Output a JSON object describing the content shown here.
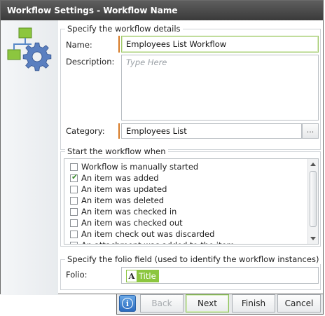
{
  "window": {
    "title": "Workflow Settings - Workflow Name"
  },
  "details": {
    "legend": "Specify the workflow details",
    "name_label": "Name:",
    "name_value": "Employees List Workflow",
    "description_label": "Description:",
    "description_placeholder": "Type Here",
    "category_label": "Category:",
    "category_value": "Employees List",
    "browse_label": "..."
  },
  "start": {
    "legend": "Start the workflow when",
    "items": [
      {
        "label": "Workflow is manually started",
        "checked": false
      },
      {
        "label": "An item was added",
        "checked": true
      },
      {
        "label": "An item was updated",
        "checked": false
      },
      {
        "label": "An item was deleted",
        "checked": false
      },
      {
        "label": "An item was checked in",
        "checked": false
      },
      {
        "label": "An item was checked out",
        "checked": false
      },
      {
        "label": "An item check out was discarded",
        "checked": false
      },
      {
        "label": "An attachment was added to the item",
        "checked": false
      }
    ]
  },
  "folio": {
    "legend": "Specify the folio field (used to identify the workflow instances)",
    "label": "Folio:",
    "token_icon": "A",
    "token_label": "Title"
  },
  "buttons": {
    "back": "Back",
    "next": "Next",
    "finish": "Finish",
    "cancel": "Cancel",
    "info_glyph": "i"
  },
  "colors": {
    "required_marker": "#d77a26",
    "accent_green": "#8cc63f",
    "title_bar": "#444444"
  }
}
